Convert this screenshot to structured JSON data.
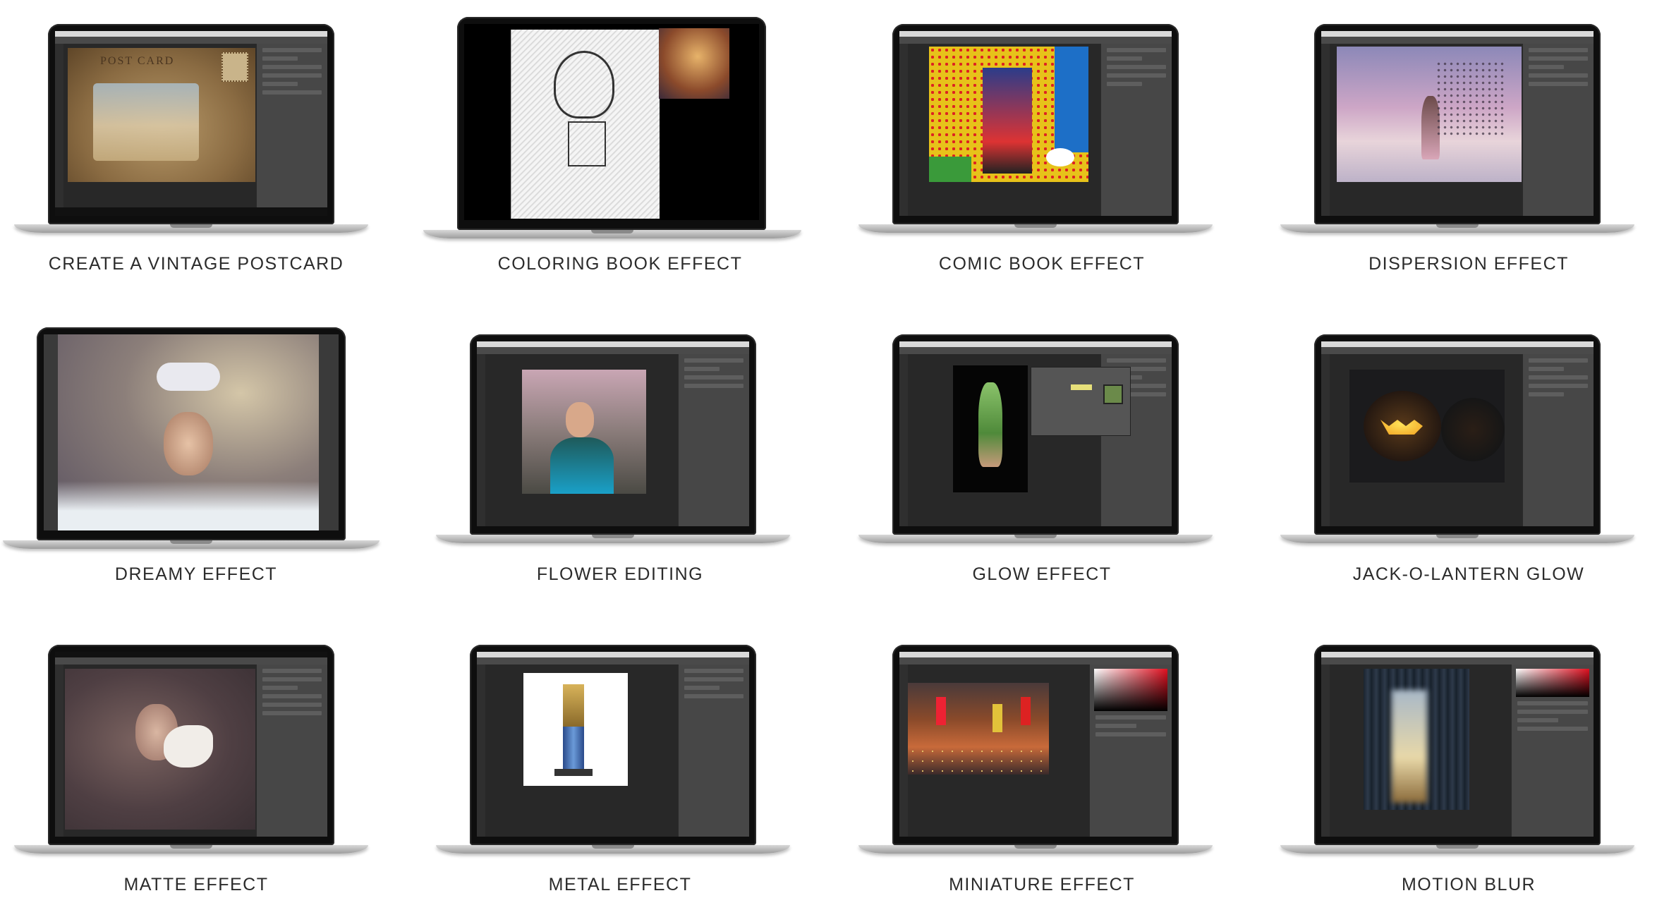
{
  "tutorials": [
    {
      "title": "CREATE A VINTAGE POSTCARD",
      "postcard_text": "POST CARD"
    },
    {
      "title": "COLORING BOOK EFFECT"
    },
    {
      "title": "COMIC BOOK EFFECT"
    },
    {
      "title": "DISPERSION EFFECT"
    },
    {
      "title": "DREAMY EFFECT"
    },
    {
      "title": "FLOWER EDITING"
    },
    {
      "title": "GLOW EFFECT"
    },
    {
      "title": "JACK-O-LANTERN GLOW"
    },
    {
      "title": "MATTE EFFECT"
    },
    {
      "title": "METAL EFFECT"
    },
    {
      "title": "MINIATURE EFFECT"
    },
    {
      "title": "MOTION BLUR"
    }
  ],
  "colors": {
    "caption": "#2b2b2b",
    "laptop_bezel": "#0e0e0e",
    "app_ui": "#3a3a3a"
  }
}
